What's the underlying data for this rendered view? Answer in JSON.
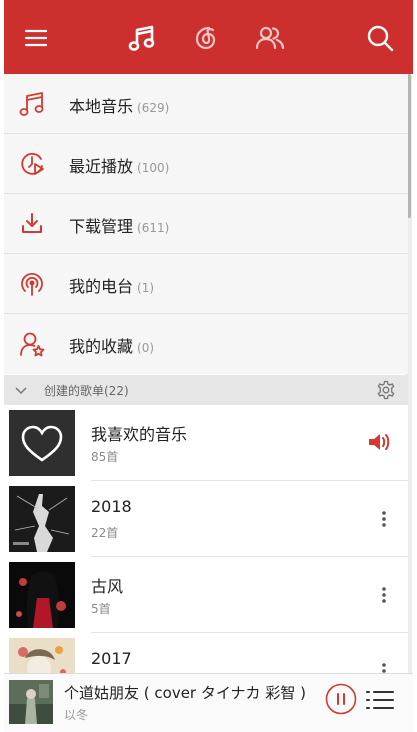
{
  "colors": {
    "brand": "#cc2f2e",
    "accent_red": "#d33a31"
  },
  "topbar": {
    "icons": [
      "menu-icon",
      "music-note-icon",
      "netease-cloud-icon",
      "friends-icon",
      "search-icon"
    ]
  },
  "menu": [
    {
      "label": "本地音乐",
      "count": "(629)",
      "icon": "music-note-icon"
    },
    {
      "label": "最近播放",
      "count": "(100)",
      "icon": "recent-play-icon"
    },
    {
      "label": "下载管理",
      "count": "(611)",
      "icon": "download-icon"
    },
    {
      "label": "我的电台",
      "count": "(1)",
      "icon": "radio-icon"
    },
    {
      "label": "我的收藏",
      "count": "(0)",
      "icon": "favorites-user-icon"
    }
  ],
  "section": {
    "title": "创建的歌单(22)"
  },
  "playlists": [
    {
      "name": "我喜欢的音乐",
      "sub": "85首"
    },
    {
      "name": "2018",
      "sub": "22首"
    },
    {
      "name": "古风",
      "sub": "5首"
    },
    {
      "name": "2017",
      "sub": ""
    }
  ],
  "player": {
    "title": "个道姑朋友 ( cover タイナカ 彩智 )",
    "artist": "以冬"
  }
}
